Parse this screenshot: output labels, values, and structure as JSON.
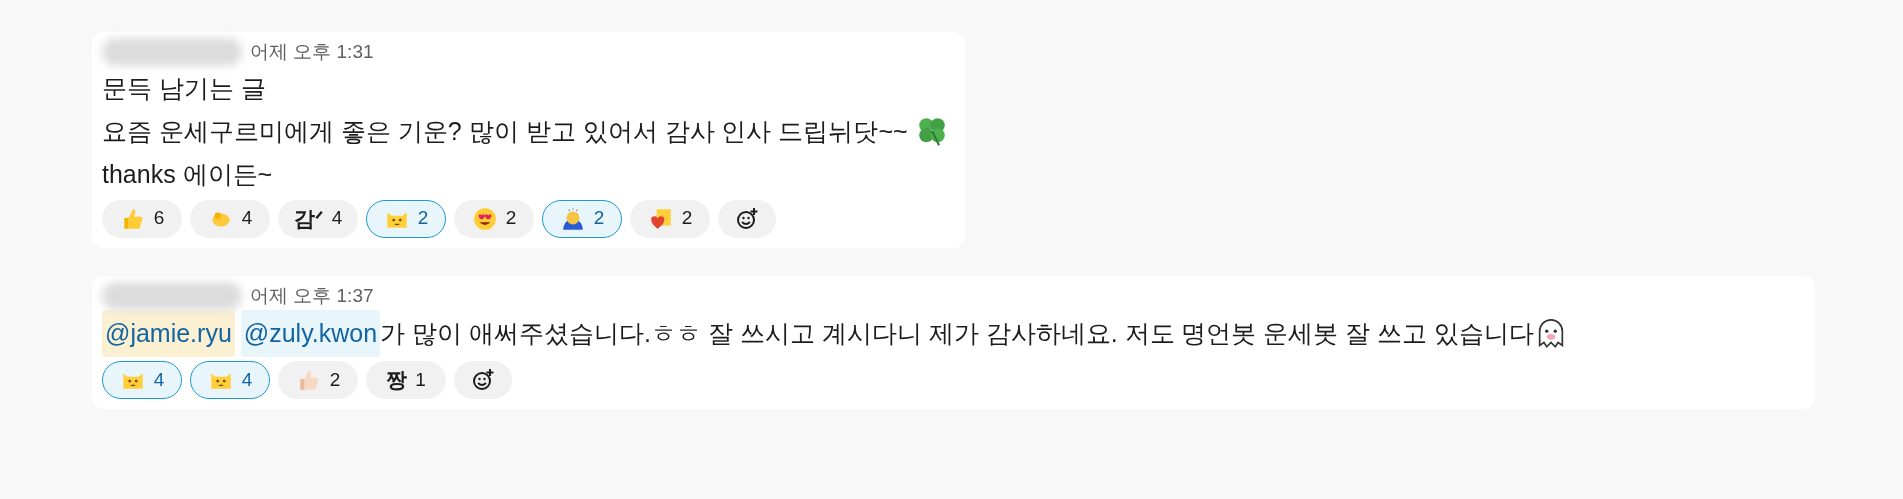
{
  "messages": [
    {
      "time": "어제 오후 1:31",
      "lines": [
        {
          "parts": [
            {
              "kind": "text",
              "text": "문득 남기는 글"
            }
          ]
        },
        {
          "parts": [
            {
              "kind": "text",
              "text": "요즘 운세구르미에게 좋은 기운? 많이 받고 있어서 감사 인사 드립뉘닷~~ "
            },
            {
              "kind": "clover"
            }
          ]
        },
        {
          "parts": [
            {
              "kind": "text",
              "text": "thanks 에이든~"
            }
          ]
        }
      ],
      "reactions": [
        {
          "kind": "thumbs",
          "count": "6",
          "selected": false
        },
        {
          "kind": "hand",
          "count": "4",
          "selected": false
        },
        {
          "kind": "label",
          "label": "감ᐟ",
          "count": "4",
          "selected": false
        },
        {
          "kind": "cat",
          "count": "2",
          "selected": true
        },
        {
          "kind": "hearteyes",
          "count": "2",
          "selected": false
        },
        {
          "kind": "bow",
          "count": "2",
          "selected": true
        },
        {
          "kind": "heartbox",
          "count": "2",
          "selected": false
        }
      ]
    },
    {
      "time": "어제 오후 1:37",
      "lines": [
        {
          "parts": [
            {
              "kind": "mention",
              "text": "@jamie.ryu",
              "self": true
            },
            {
              "kind": "mention",
              "text": "@zuly.kwon",
              "self": false
            },
            {
              "kind": "text",
              "text": "가 많이 애써주셨습니다.ㅎㅎ 잘 쓰시고 계시다니 제가 감사하네요. 저도 명언봇 운세봇 잘 쓰고 있습니다"
            },
            {
              "kind": "ghost"
            }
          ]
        }
      ],
      "reactions": [
        {
          "kind": "cat",
          "count": "4",
          "selected": true
        },
        {
          "kind": "cat",
          "count": "4",
          "selected": true
        },
        {
          "kind": "thumbslight",
          "count": "2",
          "selected": false
        },
        {
          "kind": "label",
          "label": "짱",
          "count": "1",
          "selected": false
        }
      ]
    }
  ]
}
